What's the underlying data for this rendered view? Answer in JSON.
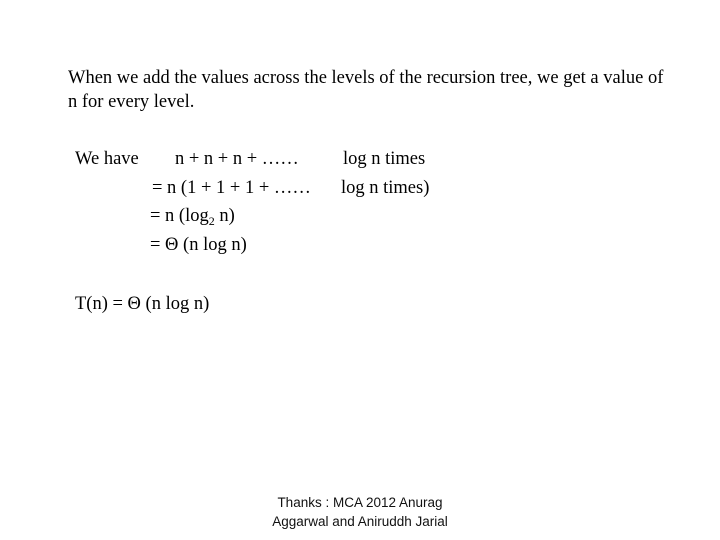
{
  "slide": {
    "intro_text": "When we add the values across the levels of the recursion tree, we get a value of n for every level.",
    "derivation": {
      "label": "We have",
      "line1_expr": "n + n + n + ……",
      "line1_suffix": "log n times",
      "line2_expr": "= n (1 + 1 + 1 + ……",
      "line2_suffix": "log n times)",
      "line3_prefix": "= n (log",
      "line3_subscript": "2",
      "line3_suffix": " n)",
      "line4_expr": "= Θ (n log n)"
    },
    "result": "T(n)  =  Θ (n log n)",
    "credits": {
      "line1": "Thanks : MCA 2012 Anurag",
      "line2": "Aggarwal and Aniruddh Jarial"
    }
  }
}
